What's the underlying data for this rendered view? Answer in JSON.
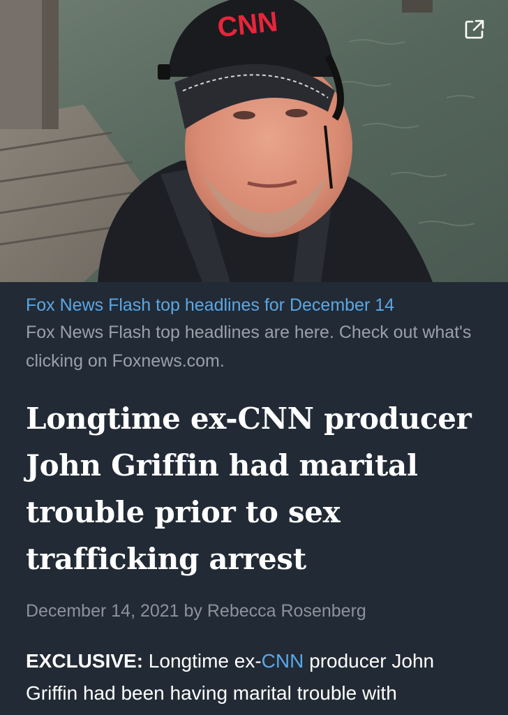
{
  "hero": {
    "cap_text": "CNN",
    "external_icon": "external-link-icon"
  },
  "caption": {
    "title": "Fox News Flash top headlines for December 14",
    "description": "Fox News Flash top headlines are here. Check out what's clicking on Foxnews.com."
  },
  "article": {
    "headline": "Longtime ex-CNN producer John Griffin had marital trouble prior to sex trafficking arrest",
    "byline": "December 14, 2021 by Rebecca Rosenberg",
    "body": {
      "lead_label": "EXCLUSIVE:",
      "text_before_link": " Longtime ex-",
      "link_text": "CNN",
      "text_after_link": " producer John Griffin had been having marital trouble with"
    }
  },
  "colors": {
    "background": "#222a35",
    "accent_link": "#5aa8e6",
    "muted_text": "#9aa1ab"
  }
}
